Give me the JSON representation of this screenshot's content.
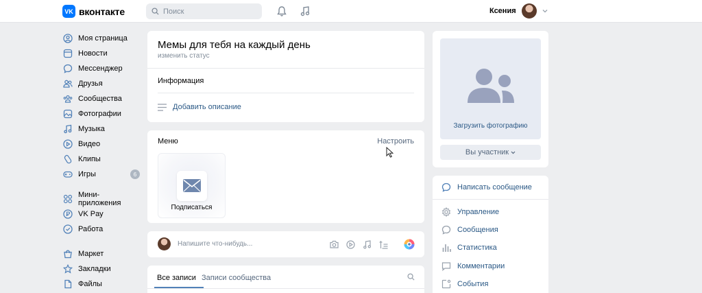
{
  "header": {
    "logo_text": "вконтакте",
    "logo_letter": "VK",
    "search_placeholder": "Поиск",
    "user_name": "Ксения",
    "icons": [
      "bell-icon",
      "music-icon",
      "chevron-down-icon"
    ]
  },
  "nav": {
    "group1": [
      {
        "label": "Моя страница",
        "icon": "user-circle-icon"
      },
      {
        "label": "Новости",
        "icon": "news-icon"
      },
      {
        "label": "Мессенджер",
        "icon": "message-icon"
      },
      {
        "label": "Друзья",
        "icon": "friends-icon"
      },
      {
        "label": "Сообщества",
        "icon": "communities-icon"
      },
      {
        "label": "Фотографии",
        "icon": "photo-icon"
      },
      {
        "label": "Музыка",
        "icon": "music-icon"
      },
      {
        "label": "Видео",
        "icon": "video-icon"
      },
      {
        "label": "Клипы",
        "icon": "clips-icon"
      },
      {
        "label": "Игры",
        "icon": "gamepad-icon",
        "badge": "6"
      }
    ],
    "group2": [
      {
        "label": "Мини-приложения",
        "icon": "apps-icon"
      },
      {
        "label": "VK Pay",
        "icon": "vkpay-icon"
      },
      {
        "label": "Работа",
        "icon": "work-icon"
      }
    ],
    "group3": [
      {
        "label": "Маркет",
        "icon": "market-icon"
      },
      {
        "label": "Закладки",
        "icon": "star-icon"
      },
      {
        "label": "Файлы",
        "icon": "file-icon"
      }
    ]
  },
  "profile": {
    "title": "Мемы для тебя на каждый день",
    "status": "изменить статус",
    "info_label": "Информация",
    "add_description": "Добавить описание"
  },
  "menu": {
    "title": "Меню",
    "configure": "Настроить",
    "tile_label": "Подписаться"
  },
  "composer": {
    "placeholder": "Напишите что-нибудь..."
  },
  "wall": {
    "tab_all": "Все записи",
    "tab_community": "Записи сообщества"
  },
  "right": {
    "upload_photo": "Загрузить фотографию",
    "member_button": "Вы участник",
    "write_message": "Написать сообщение",
    "links": [
      {
        "label": "Управление",
        "icon": "gear-icon"
      },
      {
        "label": "Сообщения",
        "icon": "message-icon"
      },
      {
        "label": "Статистика",
        "icon": "stats-icon"
      },
      {
        "label": "Комментарии",
        "icon": "comment-icon"
      },
      {
        "label": "События",
        "icon": "events-icon"
      }
    ]
  },
  "colors": {
    "accent": "#2a5885",
    "brand": "#0077ff",
    "background": "#edeef0"
  }
}
